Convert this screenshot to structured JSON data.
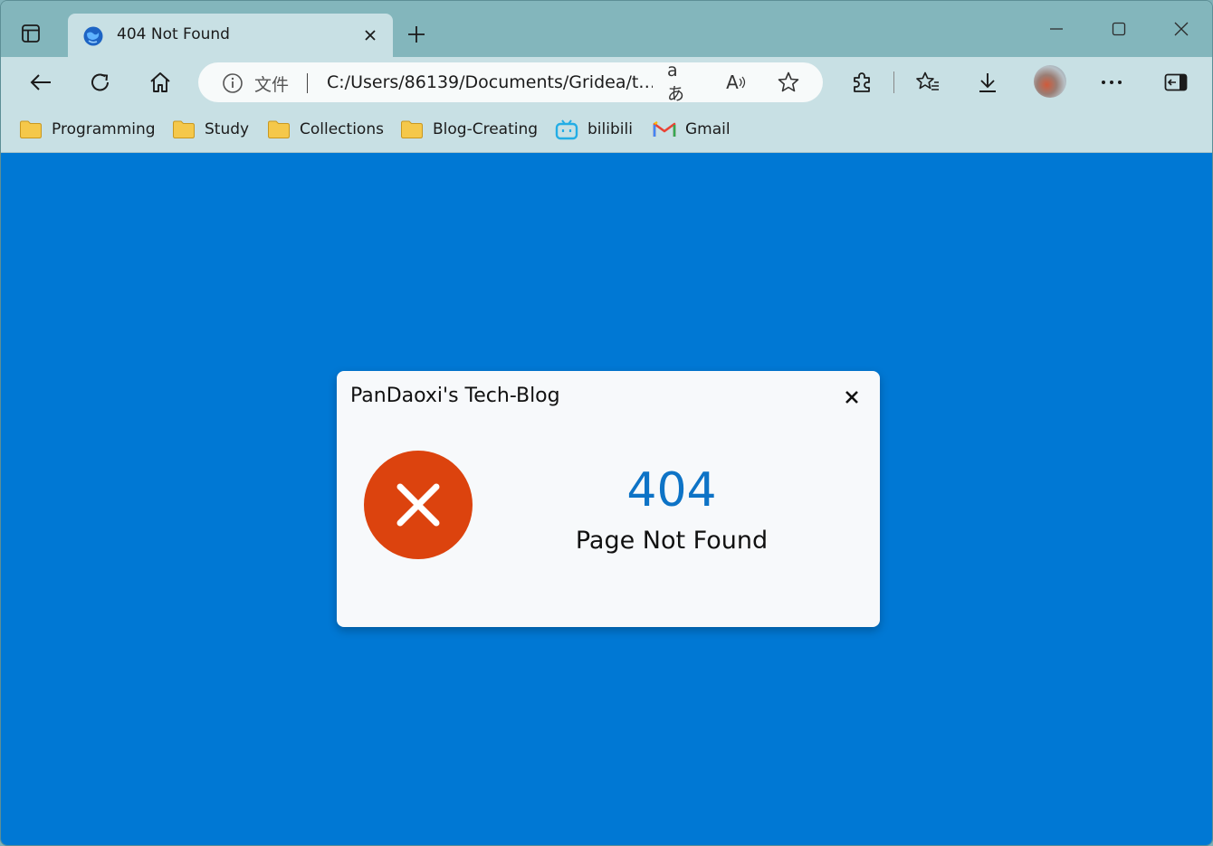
{
  "tab": {
    "title": "404 Not Found",
    "close_icon": "close-icon",
    "favicon": "edge-globe-icon"
  },
  "addressbar": {
    "scheme_label": "文件",
    "url": "C:/Users/86139/Documents/Gridea/t…",
    "translate_glyph": "aあ",
    "read_aloud_glyph": "A"
  },
  "bookmarks": [
    {
      "label": "Programming",
      "icon": "folder-icon"
    },
    {
      "label": "Study",
      "icon": "folder-icon"
    },
    {
      "label": "Collections",
      "icon": "folder-icon"
    },
    {
      "label": "Blog-Creating",
      "icon": "folder-icon"
    },
    {
      "label": "bilibili",
      "icon": "bilibili-icon"
    },
    {
      "label": "Gmail",
      "icon": "gmail-icon"
    }
  ],
  "dialog": {
    "title": "PanDaoxi's Tech-Blog",
    "code": "404",
    "message": "Page Not Found"
  },
  "colors": {
    "content_background": "#0078d4",
    "error_circle": "#dc430e",
    "code_text": "#0d73c6",
    "folder": "#f5c84a"
  }
}
